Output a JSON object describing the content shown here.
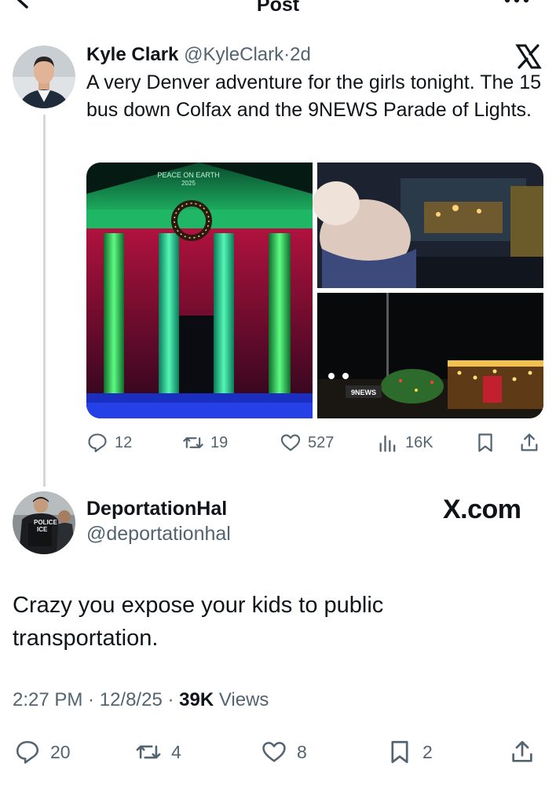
{
  "header": {
    "title": "Post"
  },
  "original_post": {
    "author_name": "Kyle Clark",
    "handle": "@KyleClark",
    "separator": "·",
    "age": "2d",
    "text": "A very Denver adventure for the girls tonight. The 15 bus down Colfax and the 9NEWS Parade of Lights.",
    "media": {
      "building_sign_line1": "PEACE ON EARTH",
      "building_sign_line2": "2025",
      "float_sign": "9NEWS"
    },
    "stats": {
      "replies": "12",
      "reposts": "19",
      "likes": "527",
      "views": "16K"
    }
  },
  "reply": {
    "author_name": "DeportationHal",
    "handle": "@deportationhal",
    "watermark": "X.com",
    "avatar_vest_text_1": "POLICE",
    "avatar_vest_text_2": "ICE",
    "text": "Crazy you expose your kids to public transportation.",
    "time": "2:27 PM",
    "date": "12/8/25",
    "views_count": "39K",
    "views_label": "Views",
    "stats": {
      "replies": "20",
      "reposts": "4",
      "likes": "8",
      "bookmarks": "2"
    }
  },
  "colors": {
    "text": "#0f1419",
    "muted": "#536471",
    "thread_line": "#cfd9de"
  }
}
